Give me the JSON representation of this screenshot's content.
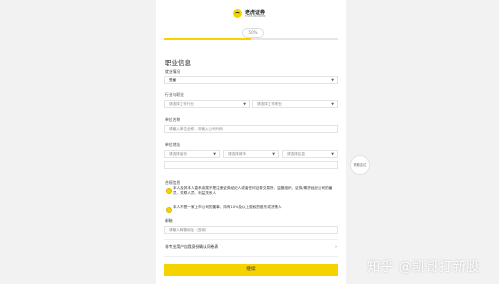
{
  "header": {
    "brand": "老虎证券",
    "brand_sub": "TIGER BROKERS"
  },
  "progress": {
    "label": "50%",
    "value": 0.5
  },
  "section": {
    "title": "职业信息"
  },
  "employment": {
    "label": "就业情况",
    "value": "受雇"
  },
  "industry": {
    "label": "行业与职业",
    "industry_placeholder": "请选择工作行业",
    "job_placeholder": "请选择工作职业"
  },
  "employer": {
    "label": "单位名称",
    "placeholder": "请输入单位全称，勿输入公司代码"
  },
  "address": {
    "label": "单位地址",
    "province": "请选择省份",
    "city": "请选择城市",
    "district": "请选择区县",
    "locate": "获取定位"
  },
  "compliance": {
    "label": "合规信息",
    "q1": "本人及其本人直系亲属不是注册证券经纪人或者任何证券交易所、监管组织、证券/期货经纪公司的雇员、关联人员、利益关系人",
    "q2": "本人不是一家上市公司的董事、持有10%及以上股权的股东或决策人"
  },
  "email": {
    "label": "邮箱",
    "placeholder": "请输入邮箱地址（选填）"
  },
  "link": {
    "label": "非专业用户自我身份确认问卷表"
  },
  "submit": {
    "label": "继续"
  },
  "watermark": {
    "text": "知乎 @凯哥打新股"
  },
  "colors": {
    "accent": "#f5d300",
    "background": "#f2f2f2"
  }
}
